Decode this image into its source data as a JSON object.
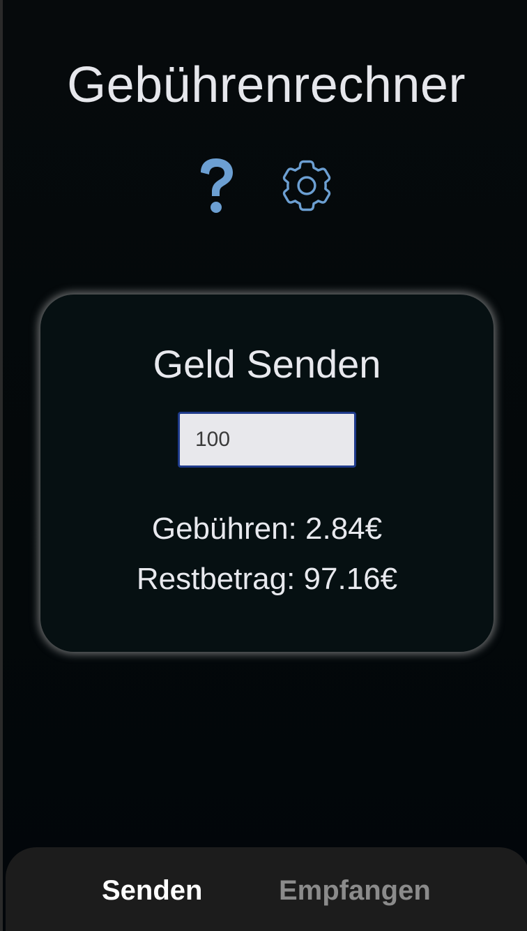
{
  "app": {
    "title": "Gebührenrechner"
  },
  "header": {
    "icons": [
      {
        "name": "help-icon",
        "glyph": "?"
      },
      {
        "name": "gear-icon"
      }
    ]
  },
  "card": {
    "title": "Geld Senden",
    "amount_value": "100",
    "fees_text": "Gebühren: 2.84€",
    "rest_text": "Restbetrag: 97.16€"
  },
  "tabs": [
    {
      "label": "Senden",
      "active": true
    },
    {
      "label": "Empfangen",
      "active": false
    }
  ],
  "colors": {
    "accent_icon": "#6c9fd2",
    "card_background": "#061012",
    "tab_active": "#ffffff",
    "tab_inactive": "#8b8b8b",
    "input_border": "#1e3a8a"
  }
}
